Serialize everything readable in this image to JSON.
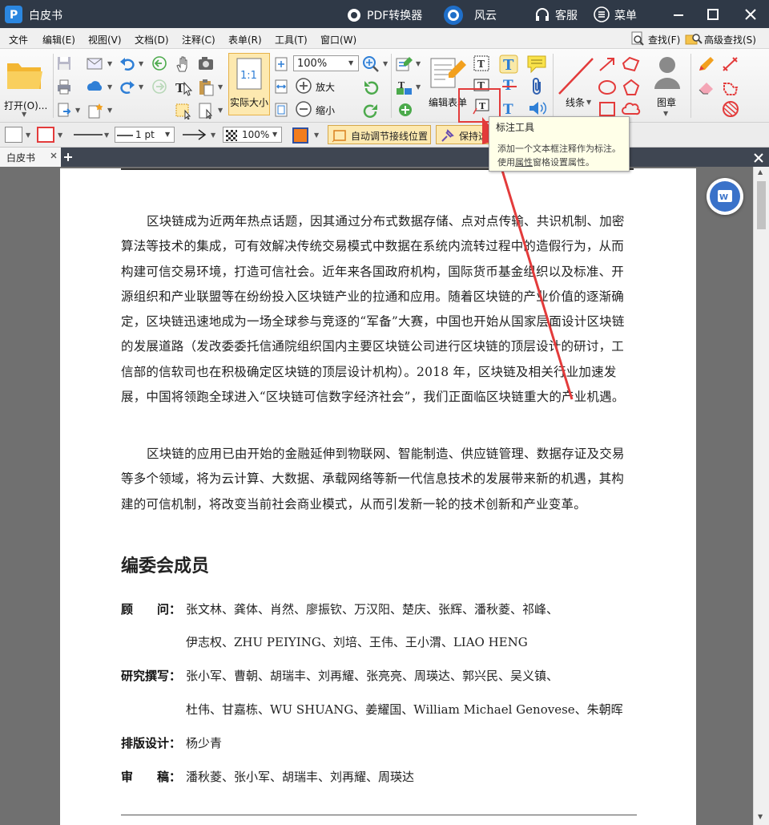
{
  "titlebar": {
    "app_name": "白皮书",
    "pdf_converter": "PDF转换器",
    "fengyun": "风云",
    "service": "客服",
    "menu": "菜单"
  },
  "menubar": {
    "items": [
      "文件",
      "编辑(E)",
      "视图(V)",
      "文档(D)",
      "注释(C)",
      "表单(R)",
      "工具(T)",
      "窗口(W)"
    ],
    "find": "查找(F)",
    "advanced_find": "高级查找(S)"
  },
  "toolbar": {
    "open": "打开(O)...",
    "actual_size": "实际大小",
    "actual_size_icon": "1:1",
    "zoom": "100%",
    "zoom_in": "放大",
    "zoom_out": "缩小",
    "edit_form": "编辑表单",
    "lines": "线条",
    "stamp": "图章"
  },
  "toolbar2": {
    "line_width": "1 pt",
    "opacity": "100%",
    "auto_adjust": "自动调节接线位置",
    "keep_tool": "保持选"
  },
  "tabs": {
    "current": "白皮书"
  },
  "tooltip": {
    "title": "标注工具",
    "line1": "添加一个文本框注释作为标注。",
    "line2_prefix": "使用",
    "line2_link": "属性",
    "line2_suffix": "窗格设置属性。"
  },
  "document": {
    "paragraph1": "区块链成为近两年热点话题，因其通过分布式数据存储、点对点传输、共识机制、加密算法等技术的集成，可有效解决传统交易模式中数据在系统内流转过程中的造假行为，从而构建可信交易环境，打造可信社会。近年来各国政府机构，国际货币基金组织以及标准、开源组织和产业联盟等在纷纷投入区块链产业的拉通和应用。随着区块链的产业价值的逐渐确定，区块链迅速地成为一场全球参与竞逐的“军备”大赛，中国也开始从国家层面设计区块链的发展道路（发改委委托信通院组织国内主要区块链公司进行区块链的顶层设计的研讨，工信部的信软司也在积极确定区块链的顶层设计机构）。2018 年，区块链及相关行业加速发展，中国将领跑全球进入“区块链可信数字经济社会”，我们正面临区块链重大的产业机遇。",
    "paragraph2": "区块链的应用已由开始的金融延伸到物联网、智能制造、供应链管理、数据存证及交易等多个领域，将为云计算、大数据、承载网络等新一代信息技术的发展带来新的机遇，其构建的可信机制，将改变当前社会商业模式，从而引发新一轮的技术创新和产业变革。",
    "heading": "编委会成员",
    "advisors_label": "顾　　问：",
    "advisors_line1": "张文林、龚体、肖然、廖振钦、万汉阳、楚庆、张辉、潘秋菱、祁峰、",
    "advisors_line2": "伊志权、ZHU PEIYING、刘培、王伟、王小渭、LIAO HENG",
    "writers_label": "研究撰写：",
    "writers_line1": "张小军、曹朝、胡瑞丰、刘再耀、张亮亮、周瑛达、郭兴民、吴义镇、",
    "writers_line2": "杜伟、甘嘉栋、WU SHUANG、姜耀国、William Michael Genovese、朱朝晖",
    "layout_label": "排版设计：",
    "layout_value": "杨少青",
    "review_label": "审　　稿：",
    "review_value": "潘秋菱、张小军、胡瑞丰、刘再耀、周瑛达"
  },
  "colors": {
    "titlebar": "#2f3947",
    "accent": "#e33b3b",
    "icon_blue": "#2f7fd6",
    "icon_orange": "#f2a01e"
  }
}
